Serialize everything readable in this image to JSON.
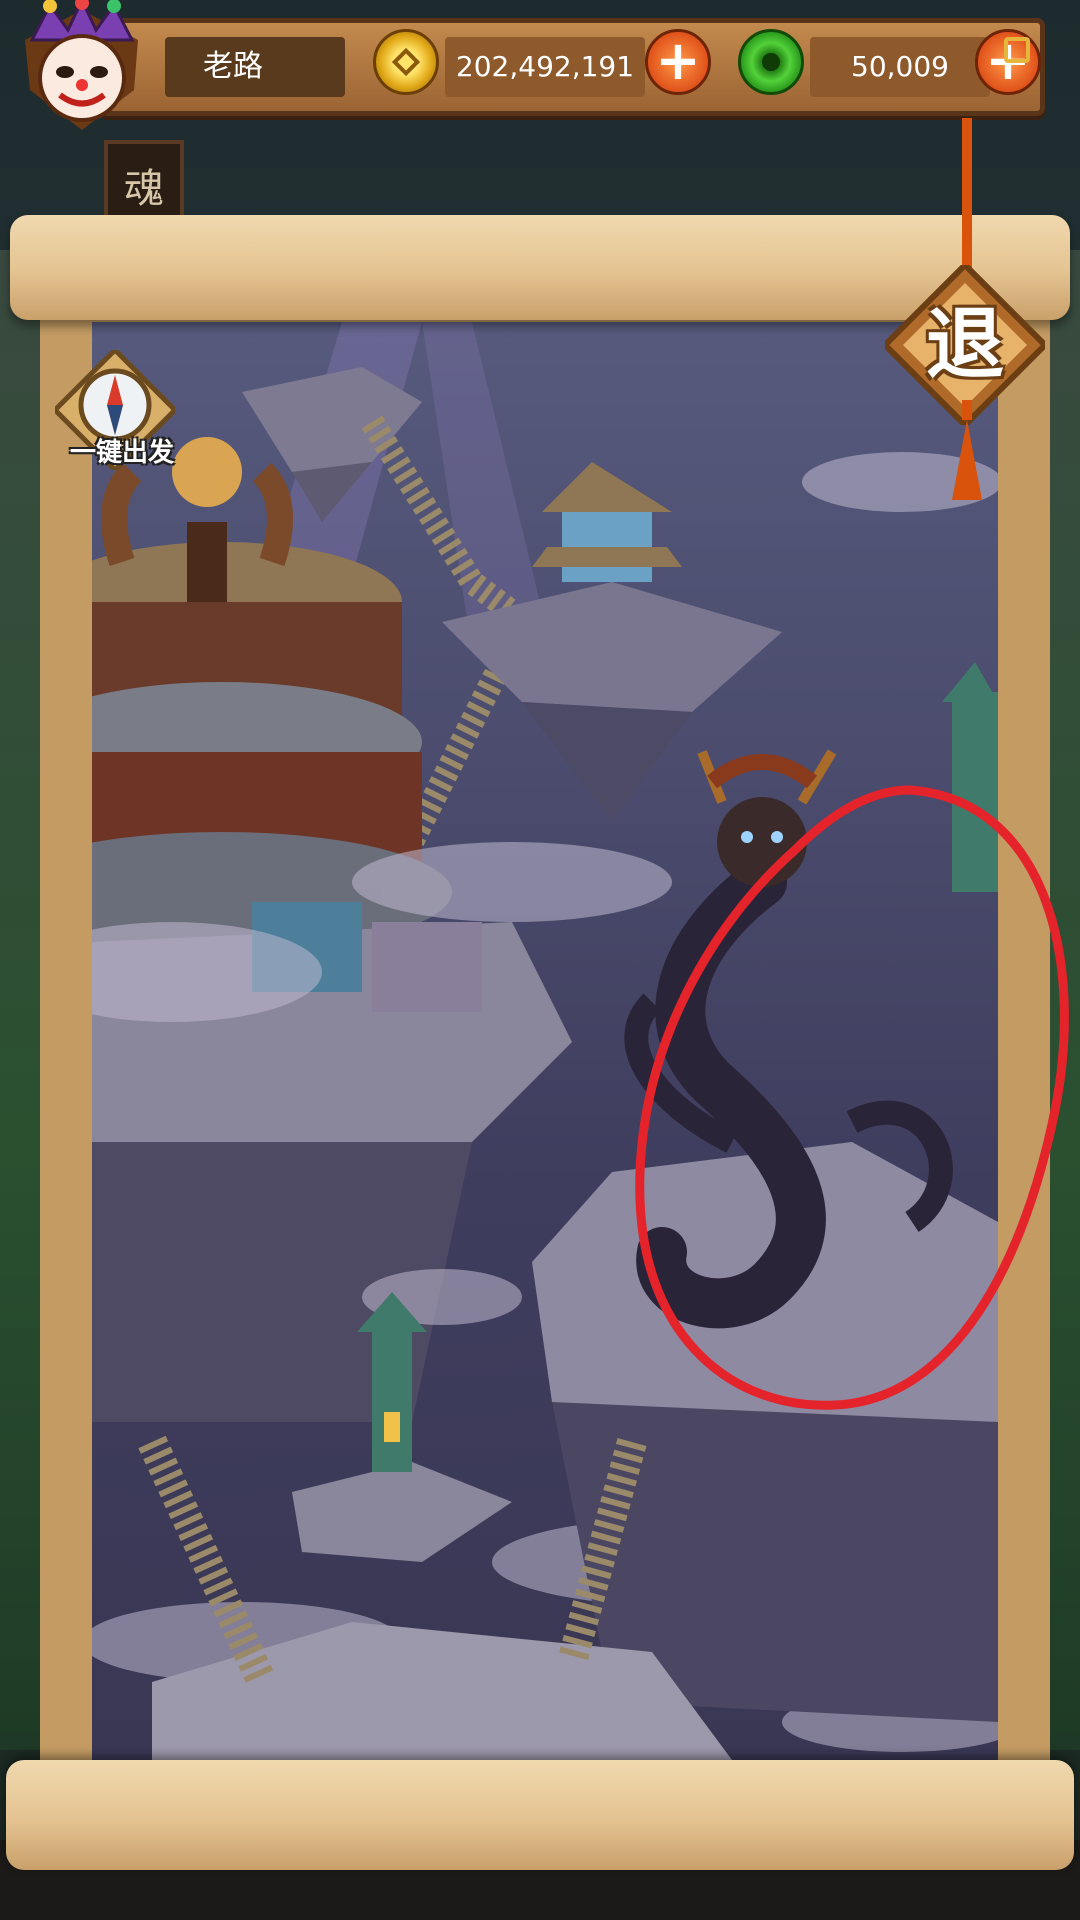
{
  "player": {
    "name": "老路"
  },
  "currency": {
    "coins": "202,492,191",
    "gems": "50,009",
    "coins_plus": "+",
    "gems_plus": "+"
  },
  "side_sign": {
    "char": "魂"
  },
  "map": {
    "auto_depart_label": "一键出发",
    "exit_label": "退"
  },
  "colors": {
    "annotation_circle": "#e5232b",
    "accent_orange": "#e0521a",
    "coin_gold": "#e1a817",
    "gem_green": "#2c9b1e"
  }
}
